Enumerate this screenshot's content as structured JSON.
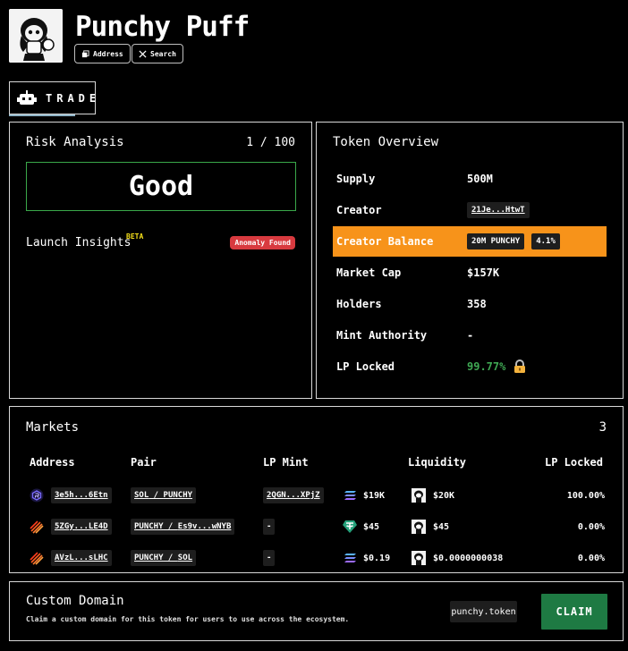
{
  "header": {
    "token_name": "Punchy Puff",
    "address_label": "Address",
    "search_label": "Search"
  },
  "trade_tab": {
    "label": "TRADE"
  },
  "risk": {
    "title": "Risk Analysis",
    "score": "1 / 100",
    "rating": "Good",
    "insights_label": "Launch Insights",
    "beta_label": "BETA",
    "anomaly_badge": "Anomaly Found"
  },
  "overview": {
    "title": "Token Overview",
    "rows": [
      {
        "key": "Supply",
        "value": "500M"
      },
      {
        "key": "Creator",
        "value": "21Je...HtwT"
      },
      {
        "key": "Creator Balance",
        "value": "20M PUNCHY",
        "extra": "4.1%"
      },
      {
        "key": "Market Cap",
        "value": "$157K"
      },
      {
        "key": "Holders",
        "value": "358"
      },
      {
        "key": "Mint Authority",
        "value": "-"
      },
      {
        "key": "LP Locked",
        "value": "99.77%"
      }
    ],
    "highlight_color": "#f7931a"
  },
  "markets": {
    "title": "Markets",
    "count": "3",
    "headers": {
      "address": "Address",
      "pair": "Pair",
      "lp_mint": "LP Mint",
      "liquidity": "Liquidity",
      "lp_locked": "LP Locked"
    },
    "rows": [
      {
        "address": "3e5h...6Etn",
        "pair_a": "SOL",
        "pair_b": "PUNCHY",
        "lp_mint": "2QGN...XPjZ",
        "liq_a": "$19K",
        "liq_b": "$20K",
        "lp_locked": "100.00%",
        "dex_icon": "raydium-icon",
        "liq_icon": "solana-icon"
      },
      {
        "address": "5ZGy...LE4D",
        "pair_a": "PUNCHY",
        "pair_b": "Es9v...wNYB",
        "lp_mint": "-",
        "liq_a": "$45",
        "liq_b": "$45",
        "lp_locked": "0.00%",
        "dex_icon": "meteora-icon",
        "liq_icon": "tether-icon"
      },
      {
        "address": "AVzL...sLHC",
        "pair_a": "PUNCHY",
        "pair_b": "SOL",
        "lp_mint": "-",
        "liq_a": "$0.19",
        "liq_b": "$0.0000000038",
        "lp_locked": "0.00%",
        "dex_icon": "meteora-icon",
        "liq_icon": "solana-icon"
      }
    ]
  },
  "domain": {
    "title": "Custom Domain",
    "subtitle": "Claim a custom domain for this token for users to use across the ecosystem.",
    "input_value": "punchy.token",
    "claim_label": "CLAIM"
  }
}
